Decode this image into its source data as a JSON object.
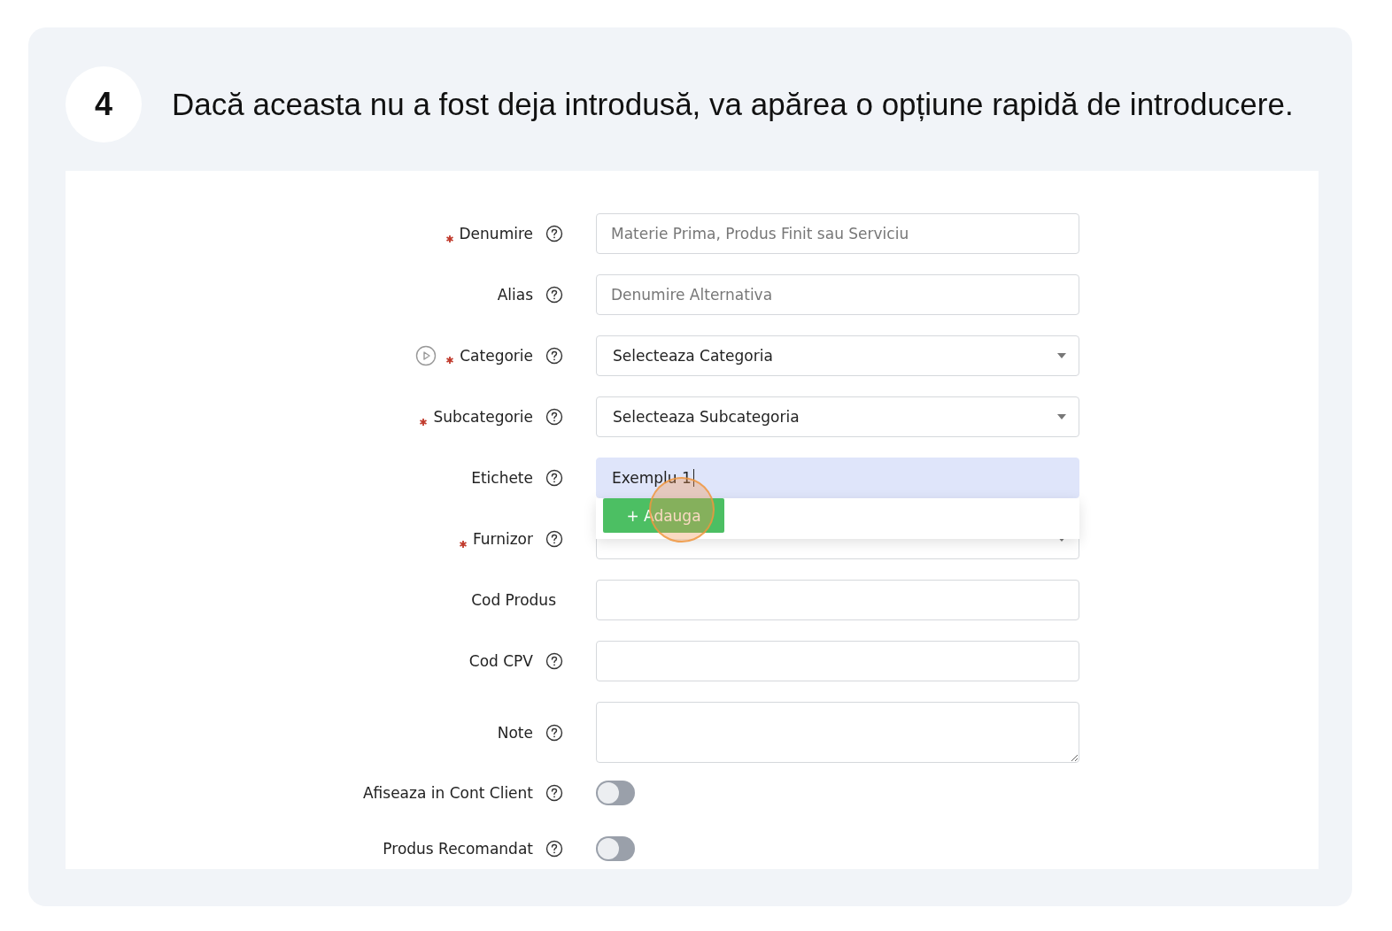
{
  "step": {
    "number": "4",
    "text": "Dacă aceasta nu a fost deja introdusă, va apărea o opțiune rapidă de introducere."
  },
  "form": {
    "rows": [
      {
        "label": "Denumire",
        "required": true,
        "help": true,
        "video": false,
        "field": {
          "kind": "text",
          "placeholder": "Materie Prima, Produs Finit sau Serviciu"
        }
      },
      {
        "label": "Alias",
        "required": false,
        "help": true,
        "video": false,
        "field": {
          "kind": "text",
          "placeholder": "Denumire Alternativa"
        }
      },
      {
        "label": "Categorie",
        "required": true,
        "help": true,
        "video": true,
        "field": {
          "kind": "select",
          "value": "Selecteaza Categoria"
        }
      },
      {
        "label": "Subcategorie",
        "required": true,
        "help": true,
        "video": false,
        "field": {
          "kind": "select",
          "value": "Selecteaza Subcategoria"
        }
      },
      {
        "label": "Etichete",
        "required": false,
        "help": true,
        "video": false,
        "field": {
          "kind": "tags",
          "value": "Exemplu 1",
          "add_button": "+ Adauga"
        }
      },
      {
        "label": "Furnizor",
        "required": true,
        "help": true,
        "video": false,
        "field": {
          "kind": "select"
        }
      },
      {
        "label": "Cod Produs",
        "required": false,
        "help": false,
        "video": false,
        "field": {
          "kind": "text"
        }
      },
      {
        "label": "Cod CPV",
        "required": false,
        "help": true,
        "video": false,
        "field": {
          "kind": "text"
        }
      },
      {
        "label": "Note",
        "required": false,
        "help": true,
        "video": false,
        "field": {
          "kind": "textarea"
        }
      },
      {
        "label": "Afiseaza in Cont Client",
        "required": false,
        "help": true,
        "video": false,
        "field": {
          "kind": "toggle",
          "on": false
        }
      },
      {
        "label": "Produs Recomandat",
        "required": false,
        "help": true,
        "video": false,
        "field": {
          "kind": "toggle",
          "on": false
        }
      }
    ]
  }
}
